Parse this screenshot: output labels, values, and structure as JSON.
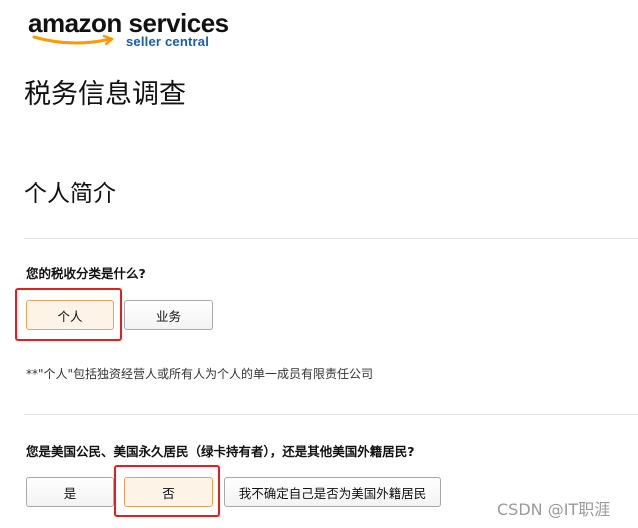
{
  "logo": {
    "brand": "amazon services",
    "sub": "seller central",
    "accent_color": "#ff9900",
    "sub_color": "#1a5ea8"
  },
  "page_title": "税务信息调查",
  "section_title": "个人简介",
  "q1": {
    "text": "您的税收分类是什么?",
    "options": [
      "个人",
      "业务"
    ],
    "selected": "个人",
    "note": "**\"个人\"包括独资经营人或所有人为个人的单一成员有限责任公司"
  },
  "q2": {
    "text": "您是美国公民、美国永久居民（绿卡持有者），还是其他美国外籍居民?",
    "options": [
      "是",
      "否",
      "我不确定自己是否为美国外籍居民"
    ],
    "selected": "否"
  },
  "watermark": "CSDN @IT职涯",
  "colors": {
    "selected_bg": "#fdf3e6",
    "selected_border": "#e3a55a",
    "highlight": "#e02020"
  }
}
